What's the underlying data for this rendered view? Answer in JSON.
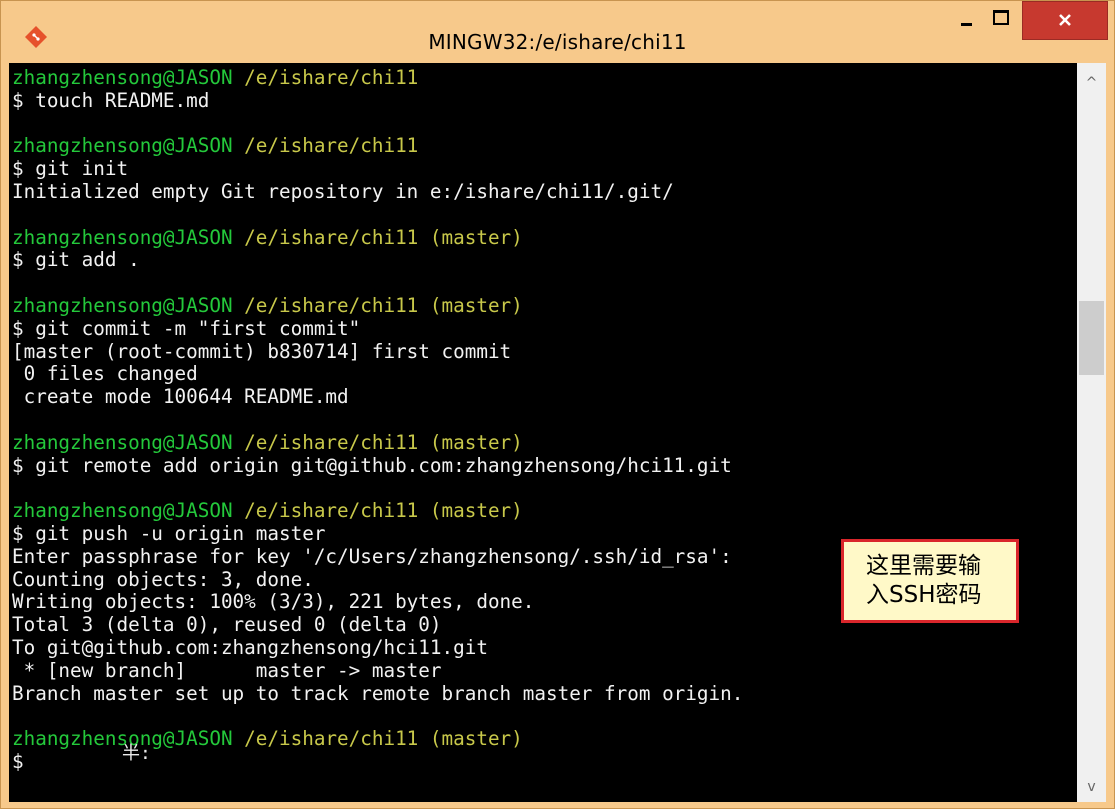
{
  "window": {
    "title": "MINGW32:/e/ishare/chi11",
    "close_glyph": "×",
    "icons": {
      "app": "git-diamond-icon",
      "minimize": "minimize-icon",
      "maximize": "maximize-icon",
      "close": "close-icon"
    }
  },
  "terminal": {
    "lines": [
      {
        "user": "zhangzhensong@JASON",
        "path": " /e/ishare/chi11",
        "text": ""
      },
      {
        "user": "",
        "path": "",
        "text": "$ touch README.md"
      },
      {
        "user": "",
        "path": "",
        "text": ""
      },
      {
        "user": "zhangzhensong@JASON",
        "path": " /e/ishare/chi11",
        "text": ""
      },
      {
        "user": "",
        "path": "",
        "text": "$ git init"
      },
      {
        "user": "",
        "path": "",
        "text": "Initialized empty Git repository in e:/ishare/chi11/.git/"
      },
      {
        "user": "",
        "path": "",
        "text": ""
      },
      {
        "user": "zhangzhensong@JASON",
        "path": " /e/ishare/chi11 (master)",
        "text": ""
      },
      {
        "user": "",
        "path": "",
        "text": "$ git add ."
      },
      {
        "user": "",
        "path": "",
        "text": ""
      },
      {
        "user": "zhangzhensong@JASON",
        "path": " /e/ishare/chi11 (master)",
        "text": ""
      },
      {
        "user": "",
        "path": "",
        "text": "$ git commit -m \"first commit\""
      },
      {
        "user": "",
        "path": "",
        "text": "[master (root-commit) b830714] first commit"
      },
      {
        "user": "",
        "path": "",
        "text": " 0 files changed"
      },
      {
        "user": "",
        "path": "",
        "text": " create mode 100644 README.md"
      },
      {
        "user": "",
        "path": "",
        "text": ""
      },
      {
        "user": "zhangzhensong@JASON",
        "path": " /e/ishare/chi11 (master)",
        "text": ""
      },
      {
        "user": "",
        "path": "",
        "text": "$ git remote add origin git@github.com:zhangzhensong/hci11.git"
      },
      {
        "user": "",
        "path": "",
        "text": ""
      },
      {
        "user": "zhangzhensong@JASON",
        "path": " /e/ishare/chi11 (master)",
        "text": ""
      },
      {
        "user": "",
        "path": "",
        "text": "$ git push -u origin master"
      },
      {
        "user": "",
        "path": "",
        "text": "Enter passphrase for key '/c/Users/zhangzhensong/.ssh/id_rsa':"
      },
      {
        "user": "",
        "path": "",
        "text": "Counting objects: 3, done."
      },
      {
        "user": "",
        "path": "",
        "text": "Writing objects: 100% (3/3), 221 bytes, done."
      },
      {
        "user": "",
        "path": "",
        "text": "Total 3 (delta 0), reused 0 (delta 0)"
      },
      {
        "user": "",
        "path": "",
        "text": "To git@github.com:zhangzhensong/hci11.git"
      },
      {
        "user": "",
        "path": "",
        "text": " * [new branch]      master -> master"
      },
      {
        "user": "",
        "path": "",
        "text": "Branch master set up to track remote branch master from origin."
      },
      {
        "user": "",
        "path": "",
        "text": ""
      },
      {
        "user": "zhangzhensong@JASON",
        "path": " /e/ishare/chi11 (master)",
        "text": ""
      },
      {
        "user": "",
        "path": "",
        "text": "$"
      }
    ],
    "ime_indicator": "半:",
    "colors": {
      "background": "#000000",
      "user": "#24c93b",
      "path": "#c8c84a",
      "text": "#f2f2f2"
    }
  },
  "scrollbar": {
    "up_arrow": "^",
    "down_arrow": "v"
  },
  "callout": {
    "text": "这里需要输\n入SSH密码",
    "border_color": "#d9262b",
    "background": "#fff9c8"
  }
}
